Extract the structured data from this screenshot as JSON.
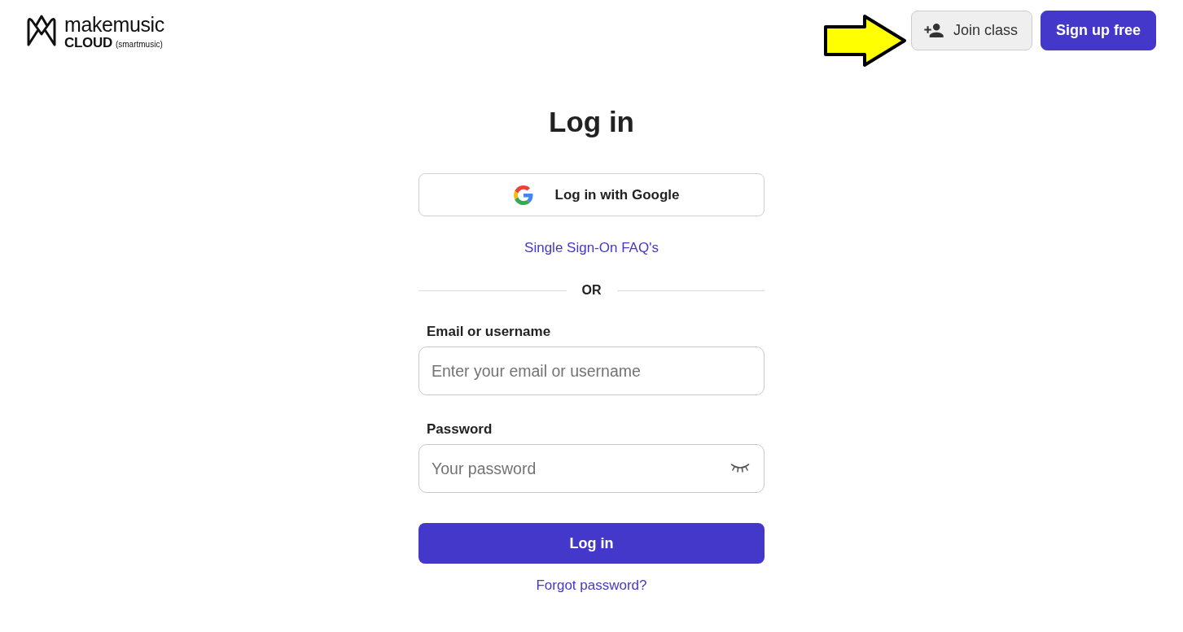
{
  "header": {
    "logo": {
      "name": "makemusic",
      "product": "CLOUD",
      "tagline": "(smartmusic)"
    },
    "buttons": [
      {
        "label": "Join class",
        "kind": "secondary"
      },
      {
        "label": "Sign up free",
        "kind": "primary"
      }
    ]
  },
  "login": {
    "title": "Log in",
    "google_button": {
      "label": "Log in with Google"
    },
    "sso_link": "Single Sign-On FAQ's",
    "divider": "OR",
    "fields": [
      {
        "label": "Email or username",
        "placeholder": "Enter your email or username",
        "kind": "email"
      },
      {
        "label": "Password",
        "placeholder": "Your password",
        "kind": "password"
      }
    ],
    "submit": "Log in",
    "forgot_link": "Forgot password?"
  }
}
